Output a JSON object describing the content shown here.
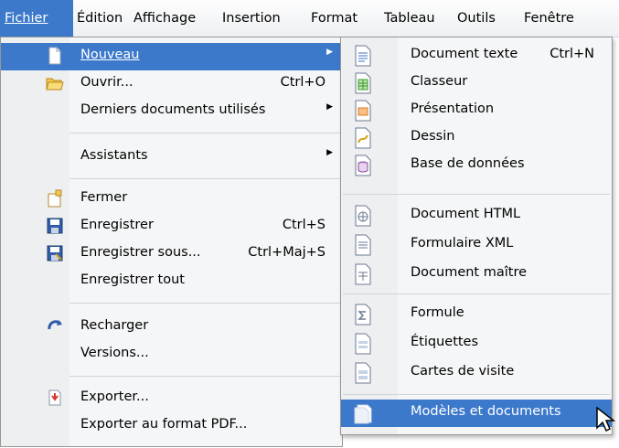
{
  "menubar": {
    "items": [
      {
        "label": "Fichier"
      },
      {
        "label": "Édition"
      },
      {
        "label": "Affichage"
      },
      {
        "label": "Insertion"
      },
      {
        "label": "Format"
      },
      {
        "label": "Tableau"
      },
      {
        "label": "Outils"
      },
      {
        "label": "Fenêtre"
      }
    ]
  },
  "file_menu": {
    "items": [
      {
        "label": "Nouveau",
        "submenu": true,
        "icon": "new-document-icon"
      },
      {
        "label": "Ouvrir...",
        "shortcut": "Ctrl+O",
        "icon": "open-folder-icon"
      },
      {
        "label": "Derniers documents utilisés",
        "submenu": true
      },
      {
        "label": "Assistants",
        "submenu": true
      },
      {
        "label": "Fermer",
        "icon": "close-document-icon"
      },
      {
        "label": "Enregistrer",
        "shortcut": "Ctrl+S",
        "icon": "save-icon"
      },
      {
        "label": "Enregistrer sous...",
        "shortcut": "Ctrl+Maj+S",
        "icon": "save-as-icon"
      },
      {
        "label": "Enregistrer tout"
      },
      {
        "label": "Recharger",
        "icon": "reload-icon"
      },
      {
        "label": "Versions..."
      },
      {
        "label": "Exporter...",
        "icon": "export-icon"
      },
      {
        "label": "Exporter au format PDF..."
      }
    ]
  },
  "new_submenu": {
    "items": [
      {
        "label": "Document texte",
        "shortcut": "Ctrl+N",
        "icon": "text-document-icon"
      },
      {
        "label": "Classeur",
        "icon": "spreadsheet-icon"
      },
      {
        "label": "Présentation",
        "icon": "presentation-icon"
      },
      {
        "label": "Dessin",
        "icon": "drawing-icon"
      },
      {
        "label": "Base de données",
        "icon": "database-icon"
      },
      {
        "label": "Document HTML",
        "icon": "html-document-icon"
      },
      {
        "label": "Formulaire XML",
        "icon": "xml-form-icon"
      },
      {
        "label": "Document maître",
        "icon": "master-document-icon"
      },
      {
        "label": "Formule",
        "icon": "formula-icon"
      },
      {
        "label": "Étiquettes",
        "icon": "labels-icon"
      },
      {
        "label": "Cartes de visite",
        "icon": "business-cards-icon"
      },
      {
        "label": "Modèles et documents",
        "icon": "templates-icon"
      }
    ]
  },
  "colors": {
    "highlight": "#3c79cb",
    "menu_bg": "#f5f6f7",
    "writer_blue": "#3a6fc4",
    "calc_green": "#3a9a2a",
    "impress_orange": "#e07a1a",
    "draw_yellow": "#d8a21a",
    "base_purple": "#8a4a9a"
  }
}
